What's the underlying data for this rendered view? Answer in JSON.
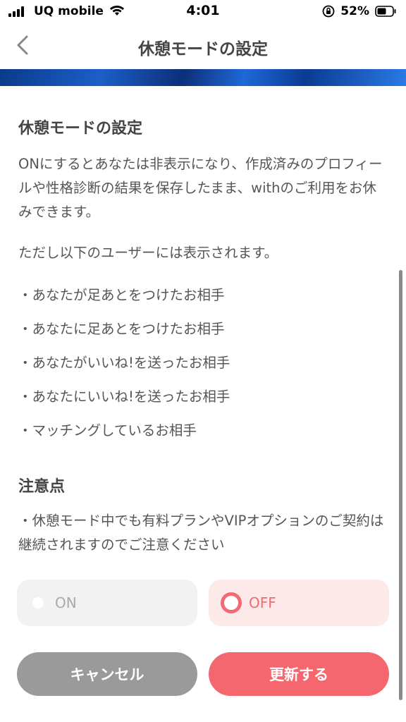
{
  "status_bar": {
    "carrier": "UQ mobile",
    "time": "4:01",
    "battery": "52%"
  },
  "nav": {
    "title": "休憩モードの設定"
  },
  "content": {
    "section1_title": "休憩モードの設定",
    "description": "ONにするとあなたは非表示になり、作成済みのプロフィールや性格診断の結果を保存したまま、withのご利用をお休みできます。",
    "visible_to_intro": "ただし以下のユーザーには表示されます。",
    "visible_to": [
      "・あなたが足あとをつけたお相手",
      "・あなたに足あとをつけたお相手",
      "・あなたがいいね!を送ったお相手",
      "・あなたにいいね!を送ったお相手",
      "・マッチングしているお相手"
    ],
    "section2_title": "注意点",
    "notice": "・休憩モード中でも有料プランやVIPオプションのご契約は継続されますのでご注意ください"
  },
  "options": {
    "on_label": "ON",
    "off_label": "OFF",
    "selected": "OFF"
  },
  "buttons": {
    "cancel": "キャンセル",
    "update": "更新する"
  },
  "colors": {
    "accent": "#f5676f",
    "selected_bg": "#fde9e9",
    "unselected_bg": "#f2f2f2",
    "cancel_bg": "#9a9a9a"
  }
}
